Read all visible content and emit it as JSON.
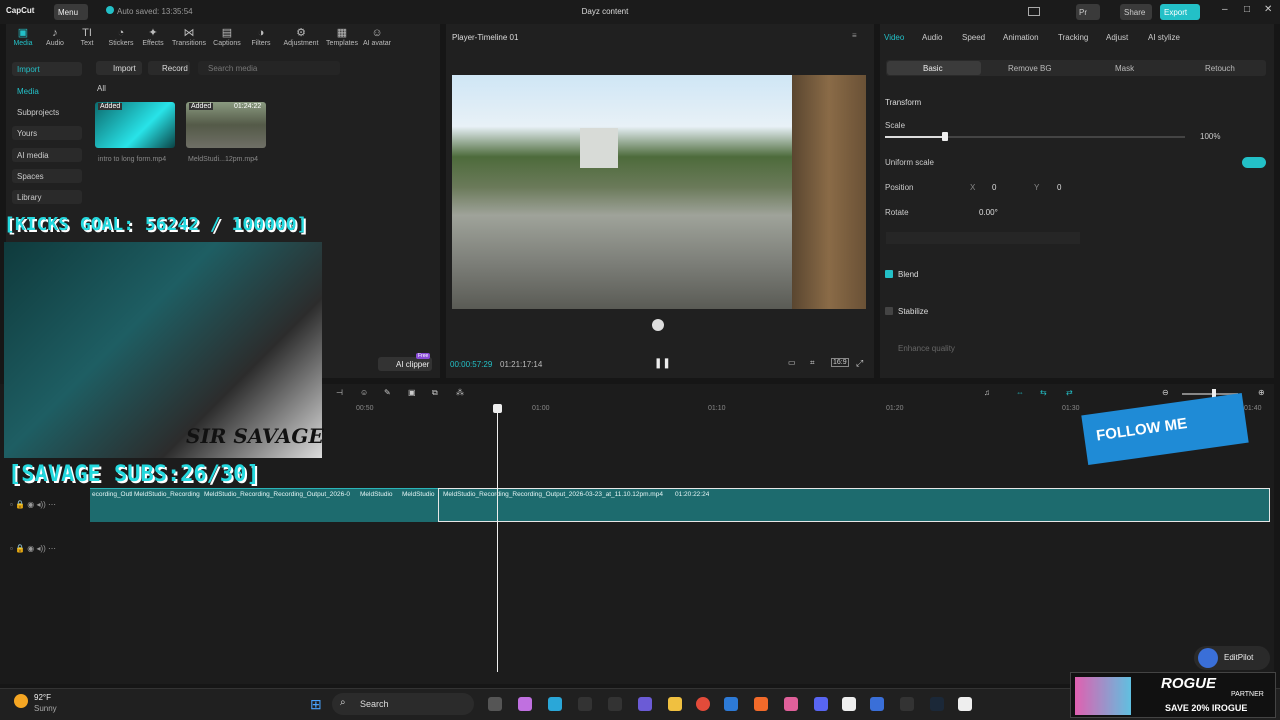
{
  "titlebar": {
    "logo": "CapCut",
    "menu": "Menu",
    "autosave": "Auto saved: 13:35:54",
    "title": "Dayz content",
    "share": "Share",
    "export": "Export"
  },
  "toptabs": [
    "Media",
    "Audio",
    "Text",
    "Stickers",
    "Effects",
    "Transitions",
    "Captions",
    "Filters",
    "Adjustment",
    "Templates",
    "AI avatar"
  ],
  "subnav": {
    "import": "Import",
    "media": "Media",
    "subprojects": "Subprojects",
    "yours": "Yours",
    "ai_media": "AI media",
    "spaces": "Spaces",
    "library": "Library"
  },
  "media": {
    "import_btn": "Import",
    "record_btn": "Record",
    "search_placeholder": "Search media",
    "all": "All",
    "clips": [
      {
        "badge": "Added",
        "name": "intro to long form.mp4"
      },
      {
        "badge": "Added",
        "duration": "01:24:22",
        "name": "MeldStudi...12pm.mp4"
      }
    ],
    "ai_clipper": "AI clipper",
    "free": "Free"
  },
  "player": {
    "title": "Player-Timeline 01",
    "current": "00:00:57:29",
    "total": "01:21:17:14",
    "ratio": "16:9"
  },
  "right": {
    "tabs": [
      "Video",
      "Audio",
      "Speed",
      "Animation",
      "Tracking",
      "Adjust",
      "AI stylize"
    ],
    "subtabs": [
      "Basic",
      "Remove BG",
      "Mask",
      "Retouch"
    ],
    "transform": "Transform",
    "scale": "Scale",
    "scale_val": "100%",
    "uniform": "Uniform scale",
    "position": "Position",
    "x": "X",
    "x_val": "0",
    "y": "Y",
    "y_val": "0",
    "rotate": "Rotate",
    "rotate_val": "0.00°",
    "blend": "Blend",
    "stabilize": "Stabilize",
    "enhance": "Enhance quality"
  },
  "timeline": {
    "ticks": [
      "00:50",
      "01:00",
      "01:10",
      "01:20",
      "01:30",
      "01:40"
    ],
    "clip_small": "ecording_Outl",
    "clip_a": "MeldStudio_Recording",
    "clip_b": "MeldStudio_Recording_Recording_Output_2026-0",
    "clip_c": "MeldStudio",
    "clip_d": "MeldStudio",
    "clip_main": "MeldStudio_Recording_Recording_Output_2026-03-23_at_11.10.12pm.mp4",
    "clip_main_dur": "01:20:22:24"
  },
  "overlay": {
    "kicks": "[KICKS GOAL: 56242 / 100000]",
    "subs": "[SAVAGE SUBS:26/30]",
    "name": "SIR SAVAGE",
    "follow": "FOLLOW ME"
  },
  "editpilot": "EditPilot",
  "taskbar": {
    "temp": "92°F",
    "weather": "Sunny",
    "search": "Search"
  },
  "ad": {
    "brand": "ROGUE",
    "partner": "PARTNER",
    "promo": "SAVE 20% IROGUE"
  }
}
